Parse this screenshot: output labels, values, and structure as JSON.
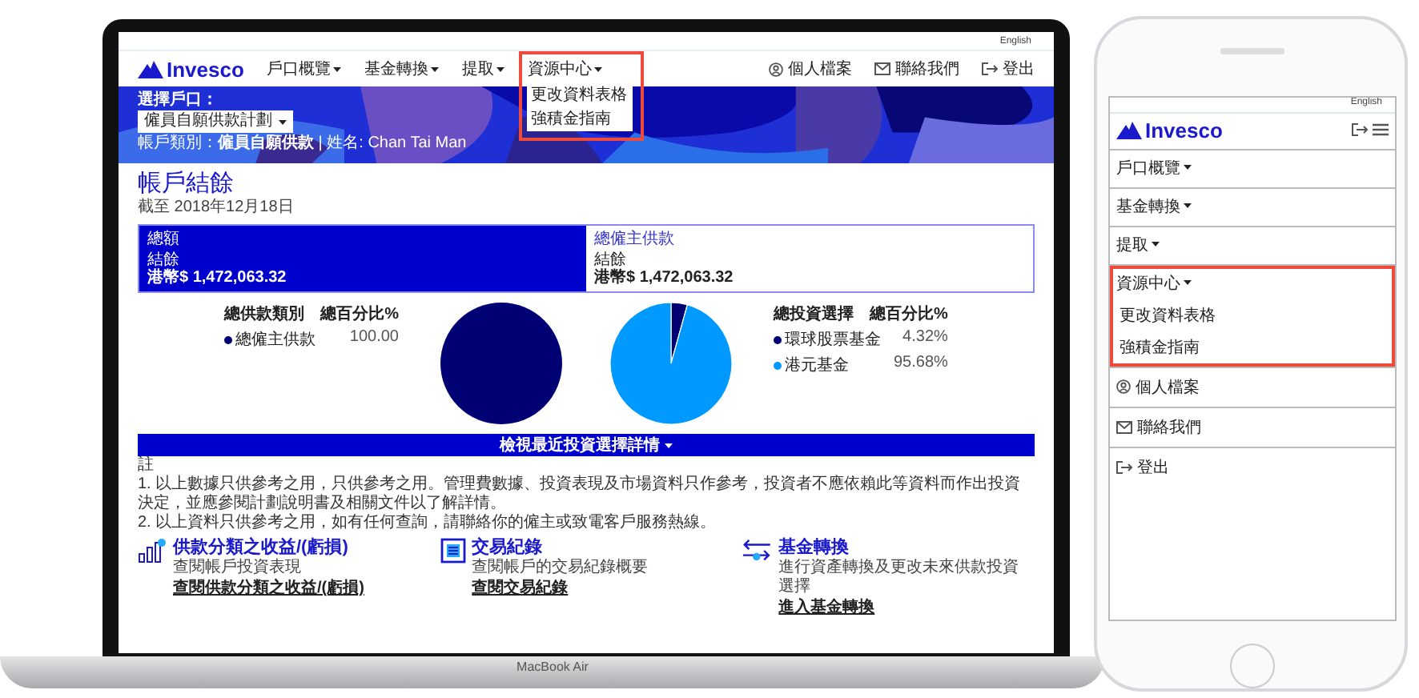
{
  "laptop": {
    "label": "MacBook Air",
    "screen": {
      "language": "English",
      "logo": "Invesco",
      "nav": [
        {
          "label": "戶口概覽",
          "highlighted": false
        },
        {
          "label": "基金轉換",
          "highlighted": false
        },
        {
          "label": "提取",
          "highlighted": false
        },
        {
          "label": "資源中心",
          "highlighted": true,
          "submenu": [
            "更改資料表格",
            "強積金指南"
          ]
        }
      ],
      "user_links": [
        {
          "kind": "profile",
          "label": "個人檔案"
        },
        {
          "kind": "contact",
          "label": "聯絡我們"
        },
        {
          "kind": "logout",
          "label": "登出"
        }
      ],
      "banner": {
        "account_label": "選擇戶口：",
        "account_select": "僱員自願供款計劃",
        "breadcrumb": "帳戶類別：**僱員自願供款** | 姓名: Chan Tai Man"
      },
      "title": "帳戶結餘",
      "as_of": "截至 2018年12月18日",
      "cards": [
        {
          "label": "總額",
          "sub_label": "結餘",
          "amount": "港幣$ 1,472,063.32",
          "selected": true
        },
        {
          "label": "總僱主供款",
          "sub_label": "結餘",
          "amount": "港幣$ 1,472,063.32",
          "selected": false
        }
      ],
      "charts": [
        {
          "legend_headers": [
            "總供款類別",
            "總百分比%"
          ],
          "legend": [
            {
              "value": "100.00",
              "color": "#000075"
            }
          ],
          "chart_data": {
            "type": "pie",
            "categories": [
              "總僱主供款"
            ],
            "values": [
              100
            ]
          }
        },
        {
          "legend_headers": [
            "總投資選擇",
            "總百分比%"
          ],
          "legend": [
            {
              "value": "4.32%",
              "color": "#000075"
            },
            {
              "value": "95.68%",
              "color": "#0099ff"
            }
          ],
          "chart_data": {
            "type": "pie",
            "categories": [
              "環球股票基金",
              "港元基金"
            ],
            "values": [
              4.32,
              95.68
            ]
          }
        }
      ],
      "details_button": "檢視最近投資選擇詳情",
      "notes_heading": "註",
      "notes": [
        "1. 以上數據只供參考之用，只供參考之用。管理費數據、投資表現及市場資料只作參考，投資者不應依賴此等資料而作出投資決定，並應參閱計劃說明書及相關文件以了解詳情。",
        "2. 以上資料只供參考之用，如有任何查詢，請聯絡你的僱主或致電客戶服務熱線。"
      ],
      "features": [
        {
          "kind": "performance",
          "title": "供款分類之收益/(虧損)",
          "subtitle": "查閱帳戶投資表現",
          "link": "查閱供款分類之收益/(虧損)"
        },
        {
          "kind": "transactions",
          "title": "交易紀錄",
          "subtitle": "查閱帳戶的交易紀錄概要",
          "link": "查閱交易紀錄"
        },
        {
          "kind": "switch",
          "title": "基金轉換",
          "subtitle": "進行資產轉換及更改未來供款投資選擇",
          "link": "進入基金轉換"
        }
      ]
    }
  },
  "phone": {
    "language": "English",
    "logo": "Invesco",
    "menu": [
      {
        "label": "戶口概覽",
        "highlighted": false
      },
      {
        "label": "基金轉換",
        "highlighted": false
      },
      {
        "label": "提取",
        "highlighted": false
      },
      {
        "label": "資源中心",
        "highlighted": true,
        "submenu": [
          "更改資料表格",
          "強積金指南"
        ]
      }
    ],
    "user_links": [
      {
        "kind": "profile",
        "label": "個人檔案"
      },
      {
        "kind": "contact",
        "label": "聯絡我們"
      },
      {
        "kind": "logout",
        "label": "登出"
      }
    ]
  }
}
